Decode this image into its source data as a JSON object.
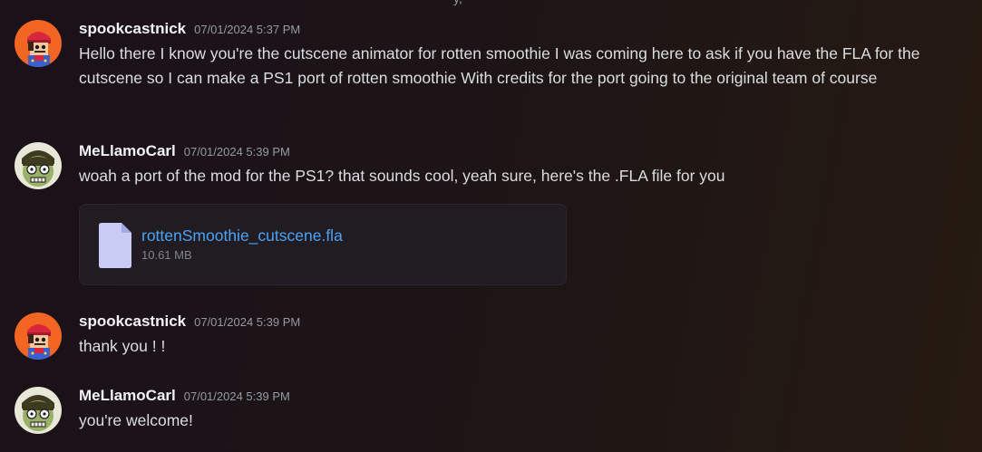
{
  "messages": [
    {
      "username": "spookcastnick",
      "timestamp": "07/01/2024 5:37 PM",
      "text": "Hello there I know you're the cutscene animator for rotten smoothie I was coming here to ask if you have the FLA for the cutscene so I can make a PS1 port of rotten smoothie With credits for the port going to the original team of course",
      "avatar_icon": "mario-style-avatar-icon"
    },
    {
      "username": "MeLlamoCarl",
      "timestamp": "07/01/2024 5:39 PM",
      "text": "woah a port of the mod for the PS1? that sounds cool, yeah sure, here's the .FLA file for you",
      "avatar_icon": "zombie-face-avatar-icon",
      "attachment": {
        "file_name": "rottenSmoothie_cutscene.fla",
        "file_size": "10.61 MB",
        "icon": "file-icon"
      }
    },
    {
      "username": "spookcastnick",
      "timestamp": "07/01/2024 5:39 PM",
      "text": "thank you ! !",
      "avatar_icon": "mario-style-avatar-icon"
    },
    {
      "username": "MeLlamoCarl",
      "timestamp": "07/01/2024 5:39 PM",
      "text": "you're welcome!",
      "avatar_icon": "zombie-face-avatar-icon"
    }
  ],
  "colors": {
    "username": "#f2f3f5",
    "timestamp": "#949ba4",
    "message_text": "#dbdee1",
    "link": "#4ba3f7",
    "attachment_bg": "#211c21"
  }
}
